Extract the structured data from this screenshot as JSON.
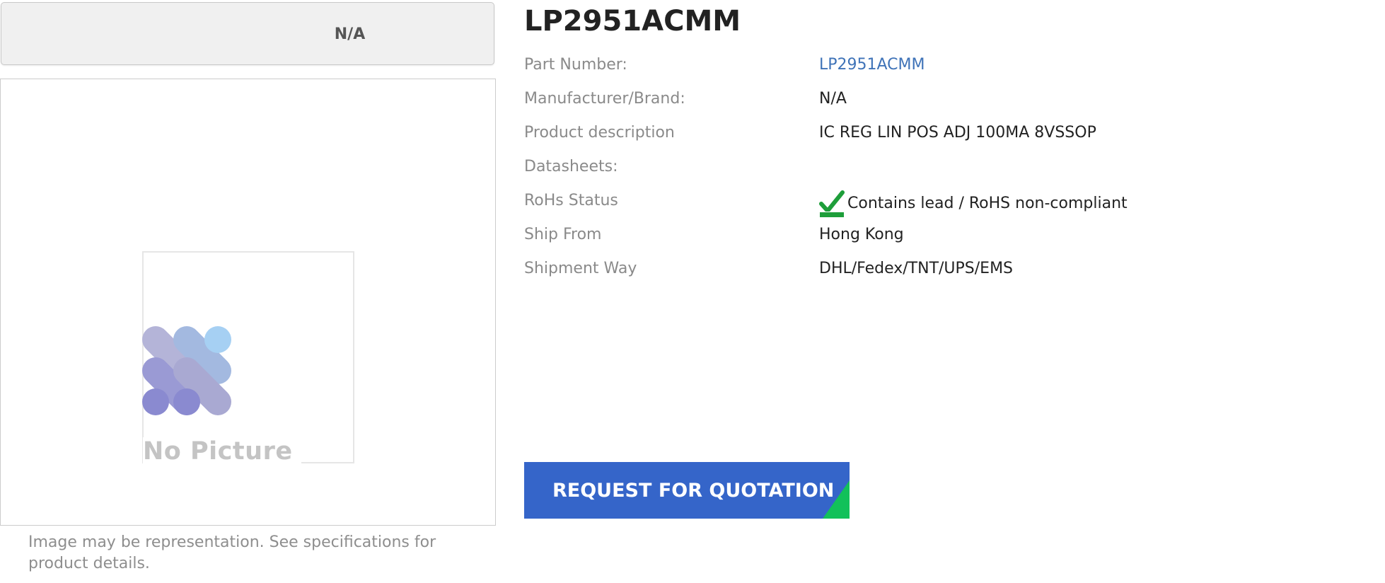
{
  "brand_box": {
    "label": "N/A"
  },
  "product_image": {
    "placeholder_text": "No Picture"
  },
  "image_caption": "Image may be representation. See specifications for product details.",
  "title": "LP2951ACMM",
  "specs": [
    {
      "label": "Part Number:",
      "value": "LP2951ACMM"
    },
    {
      "label": "Manufacturer/Brand:",
      "value": "N/A"
    },
    {
      "label": "Product description",
      "value": "IC REG LIN POS ADJ 100MA 8VSSOP"
    },
    {
      "label": "Datasheets:",
      "value": ""
    },
    {
      "label": "RoHs Status",
      "value": "Contains lead / RoHS non-compliant",
      "icon": "rohs-check-icon"
    },
    {
      "label": "Ship From",
      "value": "Hong Kong"
    },
    {
      "label": "Shipment Way",
      "value": "DHL/Fedex/TNT/UPS/EMS"
    }
  ],
  "rfq_button": {
    "label": "REQUEST FOR QUOTATION"
  },
  "colors": {
    "link": "#3f73b8",
    "button_bg": "#3565c9",
    "button_accent": "#12c15a",
    "rohs_check": "#1e9e3a"
  }
}
